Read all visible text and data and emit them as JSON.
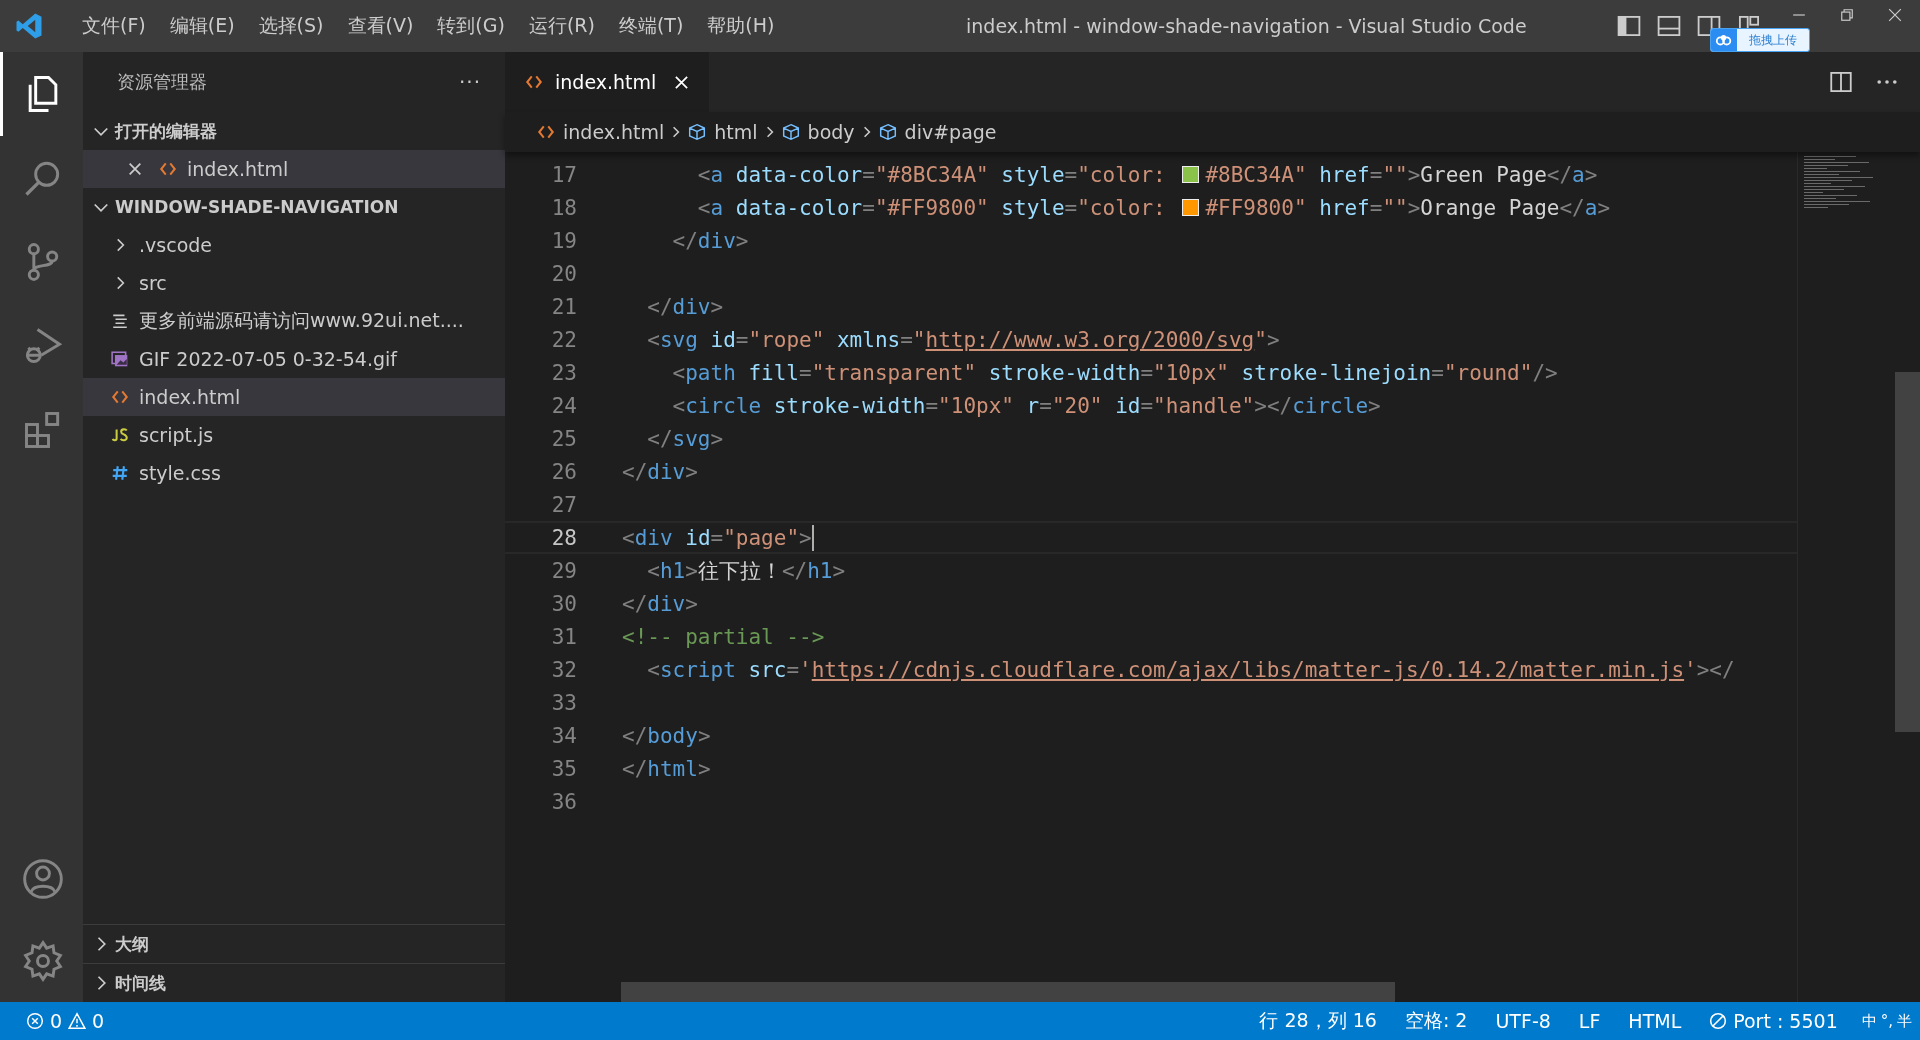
{
  "title_bar": {
    "menus": [
      "文件(F)",
      "编辑(E)",
      "选择(S)",
      "查看(V)",
      "转到(G)",
      "运行(R)",
      "终端(T)",
      "帮助(H)"
    ],
    "title": "index.html - window-shade-navigation - Visual Studio Code",
    "upload_widget": {
      "label": "拖拽上传"
    }
  },
  "activity_bar": [
    {
      "kind": "explorer",
      "selected": true
    },
    {
      "kind": "search",
      "selected": false
    },
    {
      "kind": "source-control",
      "selected": false
    },
    {
      "kind": "run-debug",
      "selected": false
    },
    {
      "kind": "extensions",
      "selected": false
    }
  ],
  "activity_bar_bottom": [
    {
      "kind": "account"
    },
    {
      "kind": "settings"
    }
  ],
  "sidebar": {
    "title": "资源管理器",
    "more": "···",
    "open_editors": {
      "title": "打开的编辑器",
      "expanded": true,
      "items": [
        {
          "label": "index.html",
          "kind": "html",
          "selected": true
        }
      ]
    },
    "project": {
      "title": "WINDOW-SHADE-NAVIGATION",
      "expanded": true,
      "items": [
        {
          "label": ".vscode",
          "kind": "folder",
          "selected": false
        },
        {
          "label": "src",
          "kind": "folder",
          "selected": false
        },
        {
          "label": "更多前端源码请访问www.92ui.net....",
          "kind": "text",
          "selected": false
        },
        {
          "label": "GIF 2022-07-05 0-32-54.gif",
          "kind": "image",
          "selected": false
        },
        {
          "label": "index.html",
          "kind": "html",
          "selected": true
        },
        {
          "label": "script.js",
          "kind": "js",
          "selected": false
        },
        {
          "label": "style.css",
          "kind": "css",
          "selected": false
        }
      ]
    },
    "panels": [
      {
        "title": "大纲",
        "expanded": false
      },
      {
        "title": "时间线",
        "expanded": false
      }
    ]
  },
  "tabs": [
    {
      "label": "index.html",
      "selected": true
    }
  ],
  "breadcrumbs": [
    {
      "label": "index.html",
      "kind": "file"
    },
    {
      "label": "html",
      "kind": "element"
    },
    {
      "label": "body",
      "kind": "element"
    },
    {
      "label": "div#page",
      "kind": "element"
    }
  ],
  "code": [
    {
      "number": "17",
      "current": false,
      "tokens": [
        {
          "kind": "punct",
          "text": "      <"
        },
        {
          "kind": "tag",
          "text": "a"
        },
        {
          "kind": "attr",
          "text": " data-color"
        },
        {
          "kind": "punct",
          "text": "="
        },
        {
          "kind": "string",
          "text": "\"#8BC34A\""
        },
        {
          "kind": "attr",
          "text": " style"
        },
        {
          "kind": "punct",
          "text": "="
        },
        {
          "kind": "string",
          "text": "\"color: "
        },
        {
          "kind": "swatch",
          "color": "#8bc34a"
        },
        {
          "kind": "string",
          "text": "#8BC34A\""
        },
        {
          "kind": "attr",
          "text": " href"
        },
        {
          "kind": "punct",
          "text": "="
        },
        {
          "kind": "string",
          "text": "\"\""
        },
        {
          "kind": "punct",
          "text": ">"
        },
        {
          "kind": "plain",
          "text": "Green Page"
        },
        {
          "kind": "punct",
          "text": "</"
        },
        {
          "kind": "tag",
          "text": "a"
        },
        {
          "kind": "punct",
          "text": ">"
        }
      ]
    },
    {
      "number": "18",
      "current": false,
      "tokens": [
        {
          "kind": "punct",
          "text": "      <"
        },
        {
          "kind": "tag",
          "text": "a"
        },
        {
          "kind": "attr",
          "text": " data-color"
        },
        {
          "kind": "punct",
          "text": "="
        },
        {
          "kind": "string",
          "text": "\"#FF9800\""
        },
        {
          "kind": "attr",
          "text": " style"
        },
        {
          "kind": "punct",
          "text": "="
        },
        {
          "kind": "string",
          "text": "\"color: "
        },
        {
          "kind": "swatch",
          "color": "#ff9800"
        },
        {
          "kind": "string",
          "text": "#FF9800\""
        },
        {
          "kind": "attr",
          "text": " href"
        },
        {
          "kind": "punct",
          "text": "="
        },
        {
          "kind": "string",
          "text": "\"\""
        },
        {
          "kind": "punct",
          "text": ">"
        },
        {
          "kind": "plain",
          "text": "Orange Page"
        },
        {
          "kind": "punct",
          "text": "</"
        },
        {
          "kind": "tag",
          "text": "a"
        },
        {
          "kind": "punct",
          "text": ">"
        }
      ]
    },
    {
      "number": "19",
      "current": false,
      "tokens": [
        {
          "kind": "punct",
          "text": "    </"
        },
        {
          "kind": "tag",
          "text": "div"
        },
        {
          "kind": "punct",
          "text": ">"
        }
      ]
    },
    {
      "number": "20",
      "current": false
    },
    {
      "number": "21",
      "current": false,
      "tokens": [
        {
          "kind": "punct",
          "text": "  </"
        },
        {
          "kind": "tag",
          "text": "div"
        },
        {
          "kind": "punct",
          "text": ">"
        }
      ]
    },
    {
      "number": "22",
      "current": false,
      "tokens": [
        {
          "kind": "punct",
          "text": "  <"
        },
        {
          "kind": "tag",
          "text": "svg"
        },
        {
          "kind": "attr",
          "text": " id"
        },
        {
          "kind": "punct",
          "text": "="
        },
        {
          "kind": "string",
          "text": "\"rope\""
        },
        {
          "kind": "attr",
          "text": " xmlns"
        },
        {
          "kind": "punct",
          "text": "="
        },
        {
          "kind": "string",
          "text": "\""
        },
        {
          "kind": "link",
          "text": "http://www.w3.org/2000/svg"
        },
        {
          "kind": "string",
          "text": "\""
        },
        {
          "kind": "punct",
          "text": ">"
        }
      ]
    },
    {
      "number": "23",
      "current": false,
      "tokens": [
        {
          "kind": "punct",
          "text": "    <"
        },
        {
          "kind": "tag",
          "text": "path"
        },
        {
          "kind": "attr",
          "text": " fill"
        },
        {
          "kind": "punct",
          "text": "="
        },
        {
          "kind": "string",
          "text": "\"transparent\""
        },
        {
          "kind": "attr",
          "text": " stroke-width"
        },
        {
          "kind": "punct",
          "text": "="
        },
        {
          "kind": "string",
          "text": "\"10px\""
        },
        {
          "kind": "attr",
          "text": " stroke-linejoin"
        },
        {
          "kind": "punct",
          "text": "="
        },
        {
          "kind": "string",
          "text": "\"round\""
        },
        {
          "kind": "punct",
          "text": "/>"
        }
      ]
    },
    {
      "number": "24",
      "current": false,
      "tokens": [
        {
          "kind": "punct",
          "text": "    <"
        },
        {
          "kind": "tag",
          "text": "circle"
        },
        {
          "kind": "attr",
          "text": " stroke-width"
        },
        {
          "kind": "punct",
          "text": "="
        },
        {
          "kind": "string",
          "text": "\"10px\""
        },
        {
          "kind": "attr",
          "text": " r"
        },
        {
          "kind": "punct",
          "text": "="
        },
        {
          "kind": "string",
          "text": "\"20\""
        },
        {
          "kind": "attr",
          "text": " id"
        },
        {
          "kind": "punct",
          "text": "="
        },
        {
          "kind": "string",
          "text": "\"handle\""
        },
        {
          "kind": "punct",
          "text": "></"
        },
        {
          "kind": "tag",
          "text": "circle"
        },
        {
          "kind": "punct",
          "text": ">"
        }
      ]
    },
    {
      "number": "25",
      "current": false,
      "tokens": [
        {
          "kind": "punct",
          "text": "  </"
        },
        {
          "kind": "tag",
          "text": "svg"
        },
        {
          "kind": "punct",
          "text": ">"
        }
      ]
    },
    {
      "number": "26",
      "current": false,
      "tokens": [
        {
          "kind": "punct",
          "text": "</"
        },
        {
          "kind": "tag",
          "text": "div"
        },
        {
          "kind": "punct",
          "text": ">"
        }
      ]
    },
    {
      "number": "27",
      "current": false
    },
    {
      "number": "28",
      "current": true,
      "tokens": [
        {
          "kind": "punct",
          "text": "<"
        },
        {
          "kind": "tag",
          "text": "div"
        },
        {
          "kind": "attr",
          "text": " id"
        },
        {
          "kind": "punct",
          "text": "="
        },
        {
          "kind": "string",
          "text": "\"page\""
        },
        {
          "kind": "punct",
          "text": ">"
        }
      ]
    },
    {
      "number": "29",
      "current": false,
      "tokens": [
        {
          "kind": "punct",
          "text": "  <"
        },
        {
          "kind": "tag",
          "text": "h1"
        },
        {
          "kind": "punct",
          "text": ">"
        },
        {
          "kind": "plain",
          "text": "往下拉！"
        },
        {
          "kind": "punct",
          "text": "</"
        },
        {
          "kind": "tag",
          "text": "h1"
        },
        {
          "kind": "punct",
          "text": ">"
        }
      ]
    },
    {
      "number": "30",
      "current": false,
      "tokens": [
        {
          "kind": "punct",
          "text": "</"
        },
        {
          "kind": "tag",
          "text": "div"
        },
        {
          "kind": "punct",
          "text": ">"
        }
      ]
    },
    {
      "number": "31",
      "current": false,
      "tokens": [
        {
          "kind": "comment",
          "text": "<!-- partial -->"
        }
      ]
    },
    {
      "number": "32",
      "current": false,
      "tokens": [
        {
          "kind": "punct",
          "text": "  <"
        },
        {
          "kind": "tag",
          "text": "script"
        },
        {
          "kind": "attr",
          "text": " src"
        },
        {
          "kind": "punct",
          "text": "="
        },
        {
          "kind": "string",
          "text": "'"
        },
        {
          "kind": "link",
          "text": "https://cdnjs.cloudflare.com/ajax/libs/matter-js/0.14.2/matter.min.js"
        },
        {
          "kind": "string",
          "text": "'"
        },
        {
          "kind": "punct",
          "text": "></"
        }
      ]
    },
    {
      "number": "33",
      "current": false
    },
    {
      "number": "34",
      "current": false,
      "tokens": [
        {
          "kind": "punct",
          "text": "</"
        },
        {
          "kind": "tag",
          "text": "body"
        },
        {
          "kind": "punct",
          "text": ">"
        }
      ]
    },
    {
      "number": "35",
      "current": false,
      "tokens": [
        {
          "kind": "punct",
          "text": "</"
        },
        {
          "kind": "tag",
          "text": "html"
        },
        {
          "kind": "punct",
          "text": ">"
        }
      ]
    },
    {
      "number": "36",
      "current": false
    }
  ],
  "status_bar": {
    "errors": "0",
    "warnings": "0",
    "items": [
      {
        "kind": "position",
        "label": "行 28，列 16"
      },
      {
        "kind": "plain",
        "label": "空格: 2"
      },
      {
        "kind": "plain",
        "label": "UTF-8"
      },
      {
        "kind": "plain",
        "label": "LF"
      },
      {
        "kind": "plain",
        "label": "HTML"
      },
      {
        "kind": "port",
        "label": "Port : 5501"
      }
    ],
    "tray": [
      "中",
      "°,",
      "半"
    ]
  }
}
